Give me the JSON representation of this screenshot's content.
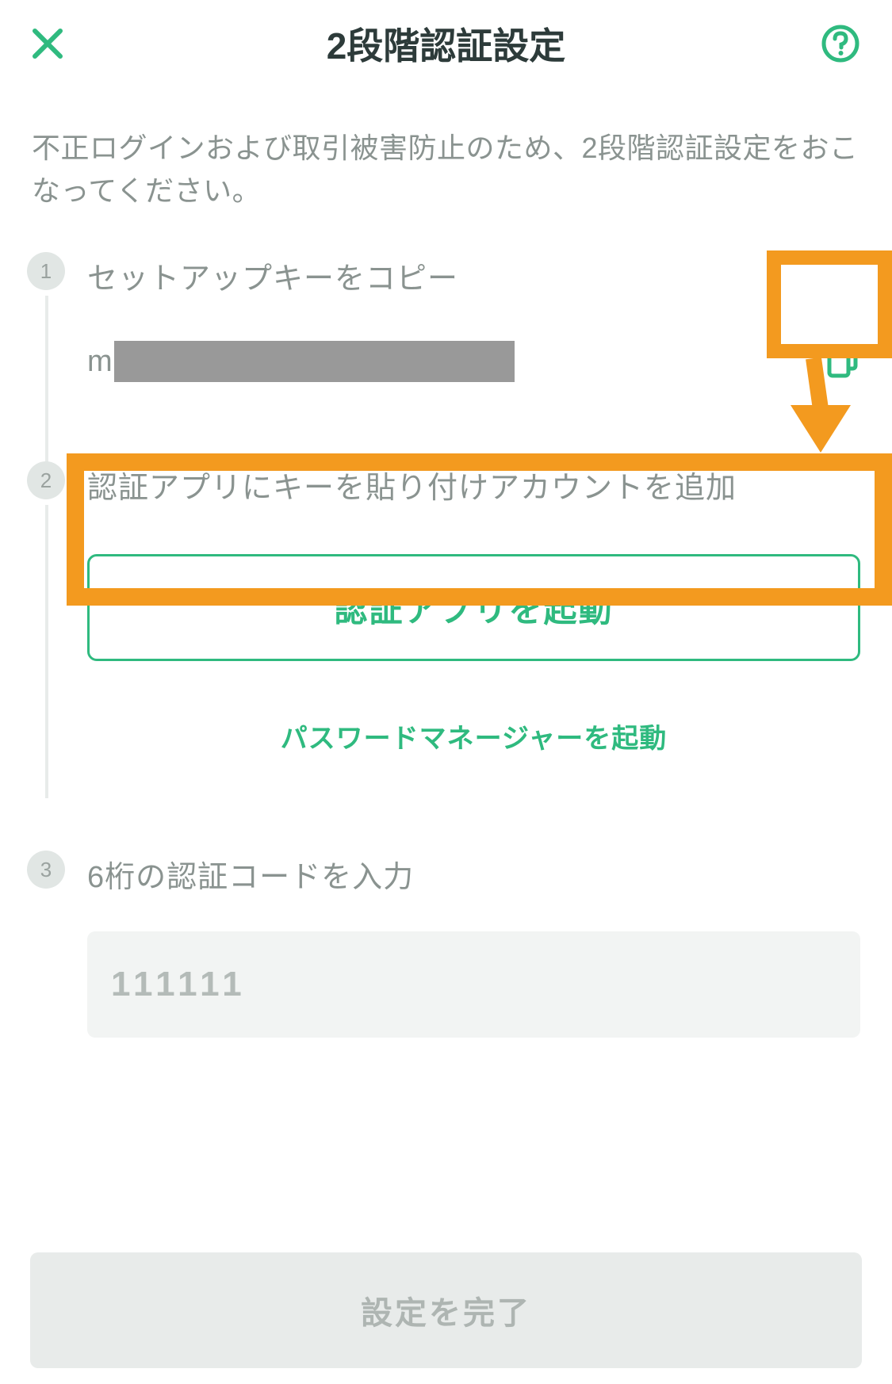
{
  "header": {
    "title": "2段階認証設定"
  },
  "description": "不正ログインおよび取引被害防止のため、2段階認証設定をおこなってください。",
  "steps": {
    "step1": {
      "number": "1",
      "title": "セットアップキーをコピー",
      "key_prefix": "m"
    },
    "step2": {
      "number": "2",
      "title": "認証アプリにキーを貼り付けアカウントを追加",
      "launch_label": "認証アプリを起動",
      "pwmgr_label": "パスワードマネージャーを起動"
    },
    "step3": {
      "number": "3",
      "title": "6桁の認証コードを入力",
      "code_placeholder": "111111"
    }
  },
  "footer": {
    "complete_label": "設定を完了"
  },
  "colors": {
    "accent": "#2fba7f",
    "highlight": "#f39a1f"
  }
}
